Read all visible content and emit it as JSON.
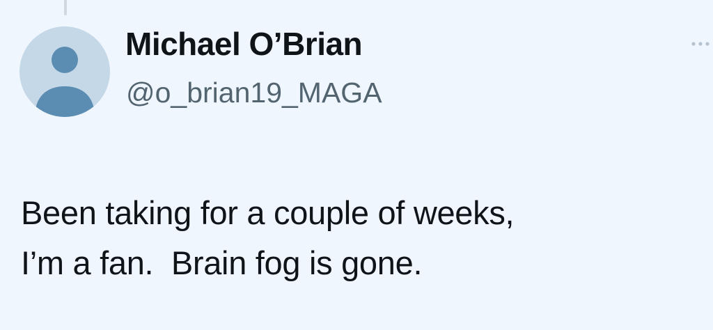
{
  "theme": {
    "background": "#f0f6fd",
    "text_primary": "#0f1419",
    "text_secondary": "#536471",
    "avatar_bg": "#c5d8e7",
    "avatar_fg": "#5b8db3"
  },
  "author": {
    "display_name": "Michael O’Brian",
    "handle": "@o_brian19_MAGA",
    "avatar_icon": "default-user-icon"
  },
  "header": {
    "more_icon": "more-horizontal-icon"
  },
  "tweet": {
    "lines": [
      "Been taking for a couple of weeks,",
      "I’m a fan.  Brain fog is gone."
    ]
  }
}
